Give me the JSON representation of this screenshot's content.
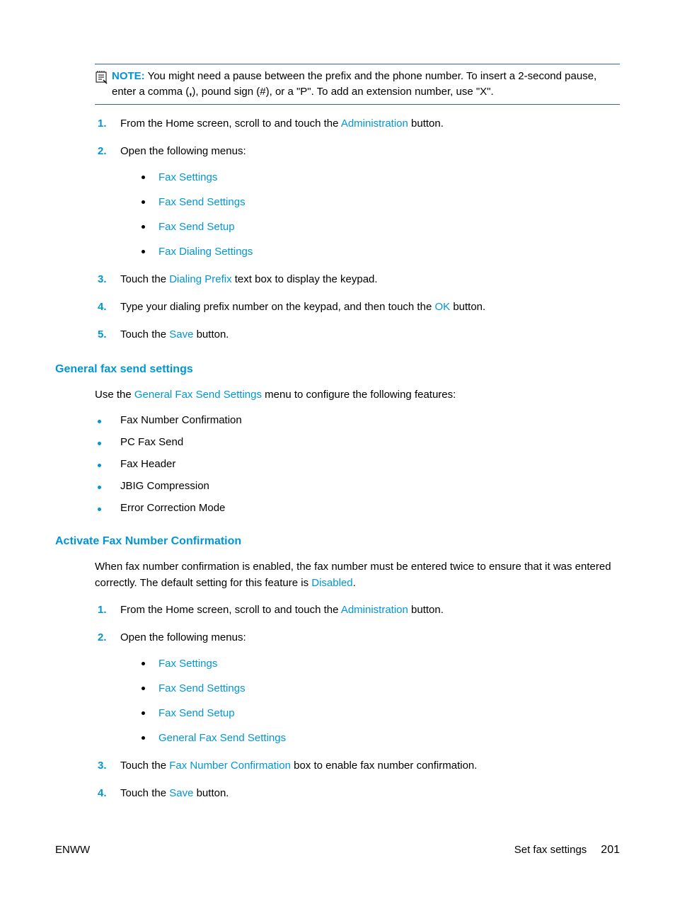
{
  "note": {
    "label": "NOTE:",
    "text_before": "You might need a pause between the prefix and the phone number. To insert a 2-second pause, enter a comma (",
    "comma": ",",
    "text_after": "), pound sign (#), or a \"P\". To add an extension number, use \"X\"."
  },
  "section1": {
    "step1_a": "From the Home screen, scroll to and touch the ",
    "step1_term": "Administration",
    "step1_b": " button.",
    "step2": "Open the following menus:",
    "menus": [
      "Fax Settings",
      "Fax Send Settings",
      "Fax Send Setup",
      "Fax Dialing Settings"
    ],
    "step3_a": "Touch the ",
    "step3_term": "Dialing Prefix",
    "step3_b": " text box to display the keypad.",
    "step4_a": "Type your dialing prefix number on the keypad, and then touch the ",
    "step4_term": "OK",
    "step4_b": " button.",
    "step5_a": "Touch the ",
    "step5_term": "Save",
    "step5_b": " button."
  },
  "heading_general": "General fax send settings",
  "general_intro_a": "Use the ",
  "general_intro_term": "General Fax Send Settings",
  "general_intro_b": " menu to configure the following features:",
  "features": [
    "Fax Number Confirmation",
    "PC Fax Send",
    "Fax Header",
    "JBIG Compression",
    "Error Correction Mode"
  ],
  "heading_activate": "Activate Fax Number Confirmation",
  "activate_intro_a": "When fax number confirmation is enabled, the fax number must be entered twice to ensure that it was entered correctly. The default setting for this feature is ",
  "activate_intro_term": "Disabled",
  "activate_intro_b": ".",
  "section2": {
    "step1_a": "From the Home screen, scroll to and touch the ",
    "step1_term": "Administration",
    "step1_b": " button.",
    "step2": "Open the following menus:",
    "menus": [
      "Fax Settings",
      "Fax Send Settings",
      "Fax Send Setup",
      "General Fax Send Settings"
    ],
    "step3_a": "Touch the ",
    "step3_term": "Fax Number Confirmation",
    "step3_b": " box to enable fax number confirmation.",
    "step4_a": "Touch the ",
    "step4_term": "Save",
    "step4_b": " button."
  },
  "footer": {
    "left": "ENWW",
    "right": "Set fax settings",
    "page": "201"
  }
}
